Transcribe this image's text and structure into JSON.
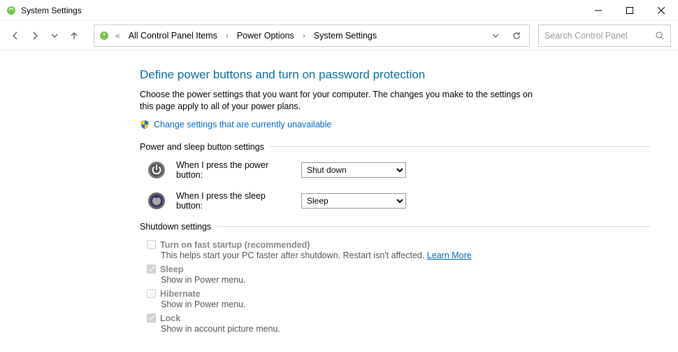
{
  "window": {
    "title": "System Settings",
    "min_btn": "Minimize",
    "max_btn": "Maximize",
    "close_btn": "Close"
  },
  "toolbar": {
    "back": "Back",
    "forward": "Forward",
    "recent": "Recent locations",
    "up": "Up",
    "breadcrumbs": {
      "item0": "All Control Panel Items",
      "item1": "Power Options",
      "item2": "System Settings"
    },
    "refresh": "Refresh",
    "search_placeholder": "Search Control Panel"
  },
  "page": {
    "heading": "Define power buttons and turn on password protection",
    "subtext": "Choose the power settings that you want for your computer. The changes you make to the settings on this page apply to all of your power plans.",
    "shield_link": "Change settings that are currently unavailable",
    "group1": "Power and sleep button settings",
    "power_button_label": "When I press the power button:",
    "power_button_value": "Shut down",
    "sleep_button_label": "When I press the sleep button:",
    "sleep_button_value": "Sleep",
    "group2": "Shutdown settings",
    "chk": {
      "fast_title": "Turn on fast startup (recommended)",
      "fast_desc": "This helps start your PC faster after shutdown. Restart isn't affected. ",
      "fast_link": "Learn More",
      "sleep_title": "Sleep",
      "sleep_desc": "Show in Power menu.",
      "hibernate_title": "Hibernate",
      "hibernate_desc": "Show in Power menu.",
      "lock_title": "Lock",
      "lock_desc": "Show in account picture menu."
    }
  }
}
